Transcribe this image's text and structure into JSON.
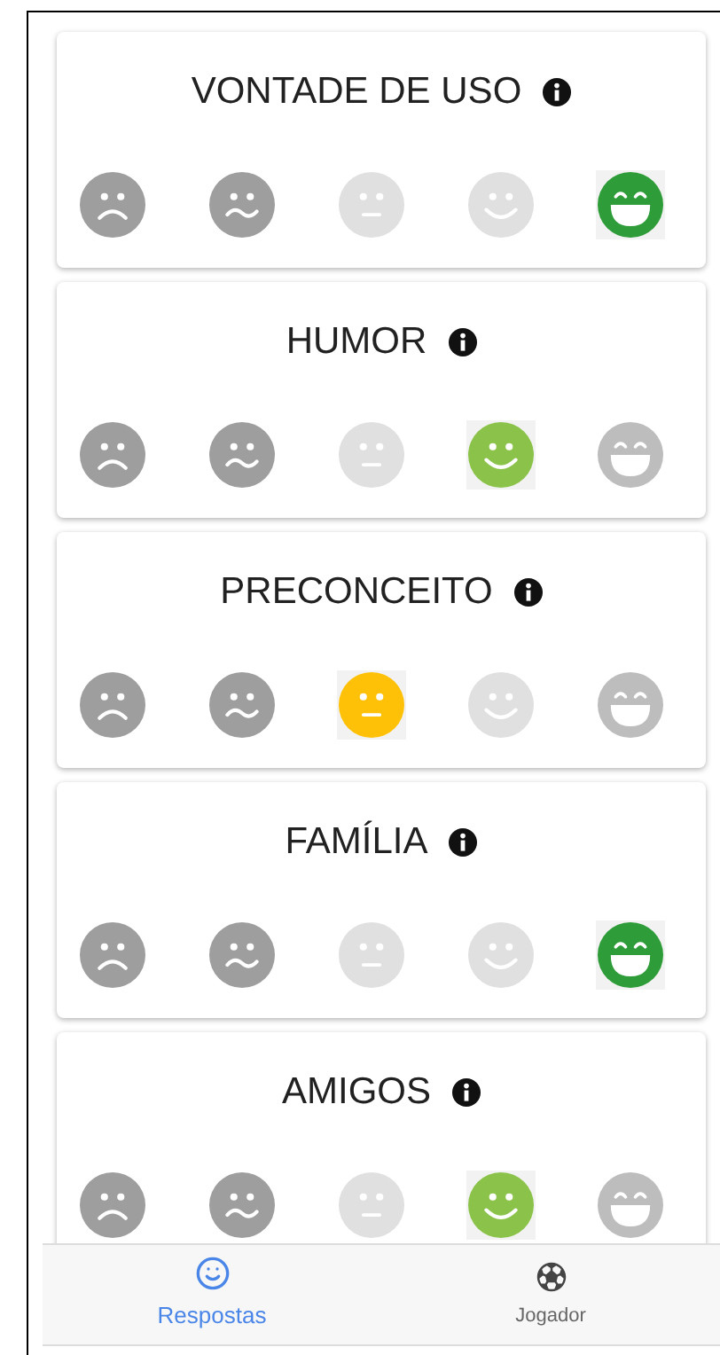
{
  "cards": [
    {
      "title": "VONTADE DE USO",
      "faces": [
        {
          "kind": "sad",
          "color": "#9e9e9e",
          "selected": false
        },
        {
          "kind": "wavy",
          "color": "#9e9e9e",
          "selected": false
        },
        {
          "kind": "neutral",
          "color": "#e0e0e0",
          "selected": false
        },
        {
          "kind": "smile",
          "color": "#e0e0e0",
          "selected": false
        },
        {
          "kind": "laugh",
          "color": "#2e9c38",
          "selected": true
        }
      ]
    },
    {
      "title": "HUMOR",
      "faces": [
        {
          "kind": "sad",
          "color": "#9e9e9e",
          "selected": false
        },
        {
          "kind": "wavy",
          "color": "#9e9e9e",
          "selected": false
        },
        {
          "kind": "neutral",
          "color": "#e0e0e0",
          "selected": false
        },
        {
          "kind": "smile",
          "color": "#8bc34a",
          "selected": true
        },
        {
          "kind": "laugh",
          "color": "#bdbdbd",
          "selected": false
        }
      ]
    },
    {
      "title": "PRECONCEITO",
      "faces": [
        {
          "kind": "sad",
          "color": "#9e9e9e",
          "selected": false
        },
        {
          "kind": "wavy",
          "color": "#9e9e9e",
          "selected": false
        },
        {
          "kind": "neutral",
          "color": "#ffc107",
          "selected": true
        },
        {
          "kind": "smile",
          "color": "#e0e0e0",
          "selected": false
        },
        {
          "kind": "laugh",
          "color": "#bdbdbd",
          "selected": false
        }
      ]
    },
    {
      "title": "FAMÍLIA",
      "faces": [
        {
          "kind": "sad",
          "color": "#9e9e9e",
          "selected": false
        },
        {
          "kind": "wavy",
          "color": "#9e9e9e",
          "selected": false
        },
        {
          "kind": "neutral",
          "color": "#e0e0e0",
          "selected": false
        },
        {
          "kind": "smile",
          "color": "#e0e0e0",
          "selected": false
        },
        {
          "kind": "laugh",
          "color": "#2e9c38",
          "selected": true
        }
      ]
    },
    {
      "title": "AMIGOS",
      "faces": [
        {
          "kind": "sad",
          "color": "#9e9e9e",
          "selected": false
        },
        {
          "kind": "wavy",
          "color": "#9e9e9e",
          "selected": false
        },
        {
          "kind": "neutral",
          "color": "#e0e0e0",
          "selected": false
        },
        {
          "kind": "smile",
          "color": "#8bc34a",
          "selected": true
        },
        {
          "kind": "laugh",
          "color": "#bdbdbd",
          "selected": false
        }
      ]
    }
  ],
  "nav": [
    {
      "kind": "answers",
      "label": "Respostas",
      "selected": true
    },
    {
      "kind": "player",
      "label": "Jogador",
      "selected": false
    }
  ]
}
